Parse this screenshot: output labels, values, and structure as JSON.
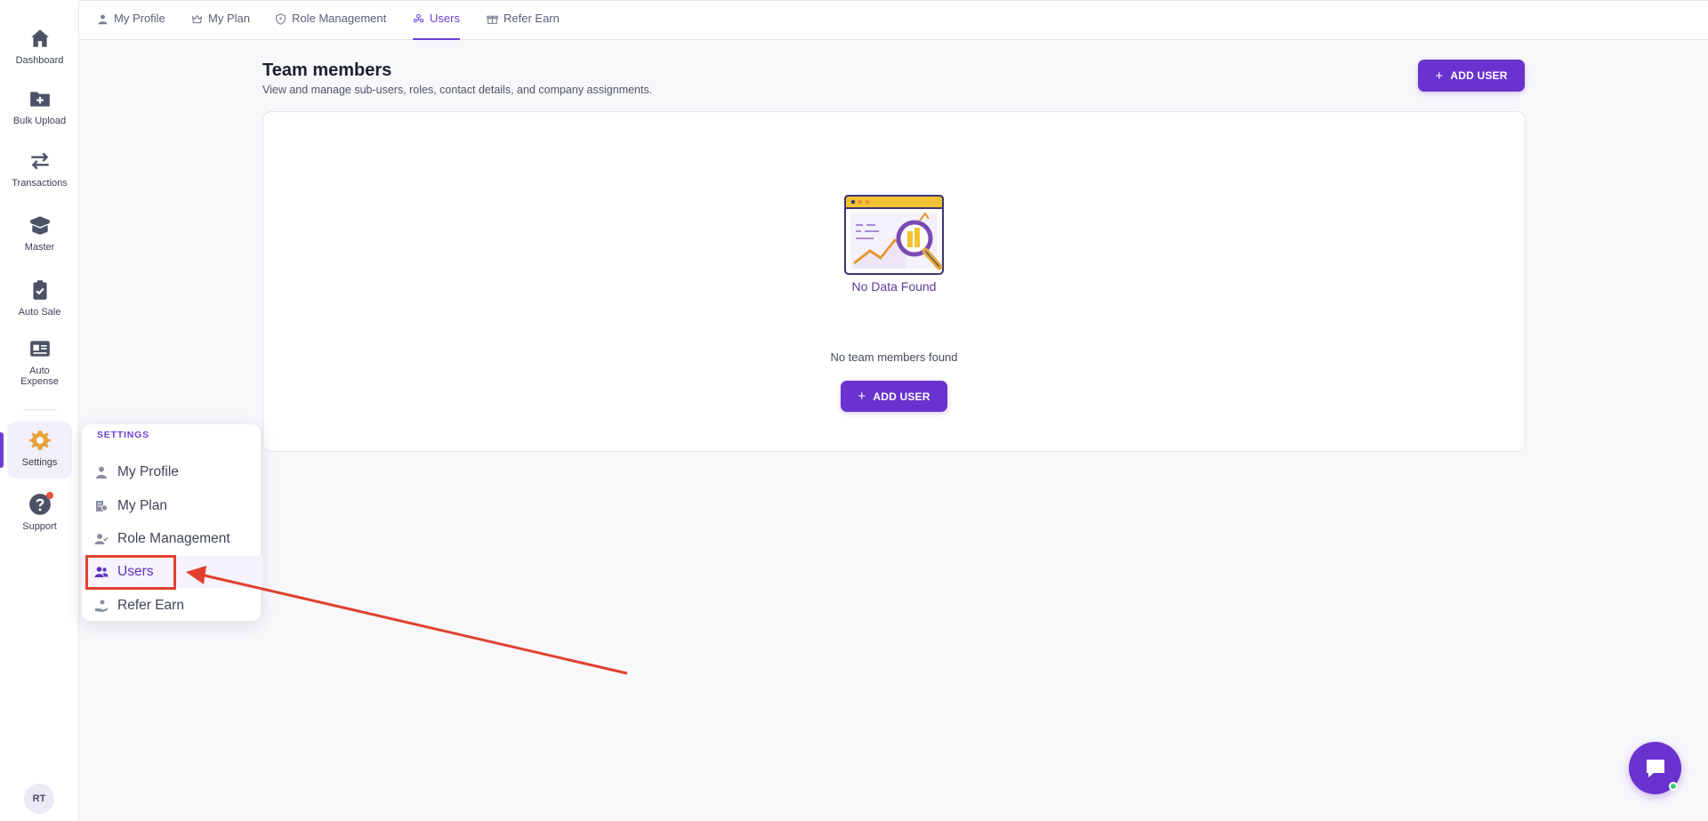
{
  "rail": {
    "items": [
      {
        "label": "Dashboard",
        "icon": "home-icon"
      },
      {
        "label": "Bulk Upload",
        "icon": "folder-plus-icon"
      },
      {
        "label": "Transactions",
        "icon": "swap-icon"
      },
      {
        "label": "Master",
        "icon": "box-icon"
      },
      {
        "label": "Auto Sale",
        "icon": "clipboard-check-icon"
      },
      {
        "label": "Auto Expense",
        "icon": "id-card-icon"
      },
      {
        "label": "Settings",
        "icon": "gear-icon"
      },
      {
        "label": "Support",
        "icon": "help-icon"
      }
    ],
    "avatar_initials": "RT"
  },
  "tabs": [
    {
      "label": "My Profile",
      "icon": "user-icon"
    },
    {
      "label": "My Plan",
      "icon": "crown-icon"
    },
    {
      "label": "Role Management",
      "icon": "shield-icon"
    },
    {
      "label": "Users",
      "icon": "users-icon",
      "active": true
    },
    {
      "label": "Refer Earn",
      "icon": "gift-icon"
    }
  ],
  "header": {
    "title": "Team members",
    "subtitle": "View and manage sub-users, roles, contact details, and company assignments.",
    "add_user_label": "ADD USER"
  },
  "empty_state": {
    "illustration_caption": "No Data Found",
    "message": "No team members found",
    "add_user_label": "ADD USER"
  },
  "settings_menu": {
    "title": "SETTINGS",
    "items": [
      {
        "label": "My Profile",
        "icon": "user-icon"
      },
      {
        "label": "My Plan",
        "icon": "plan-icon"
      },
      {
        "label": "Role Management",
        "icon": "user-check-icon"
      },
      {
        "label": "Users",
        "icon": "users-icon",
        "active": true
      },
      {
        "label": "Refer Earn",
        "icon": "hand-coin-icon"
      }
    ]
  },
  "colors": {
    "accent": "#6a33cf",
    "annotation": "#e0412f",
    "illustration_yellow": "#f2c230"
  }
}
